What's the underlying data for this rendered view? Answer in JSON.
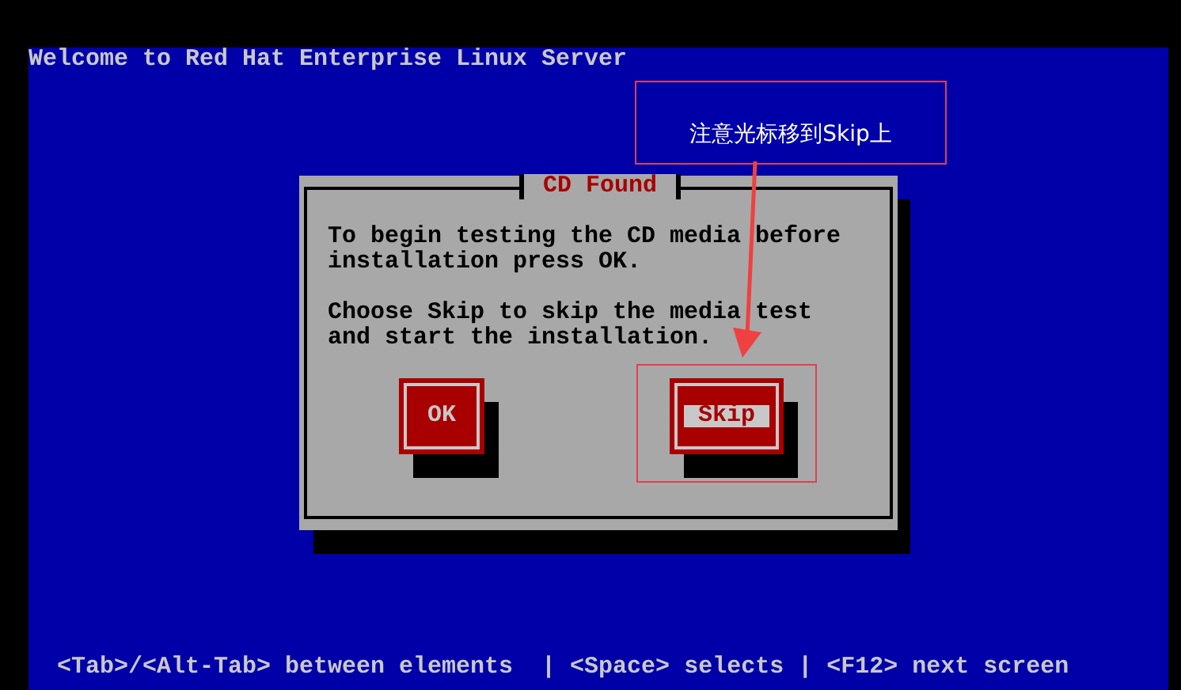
{
  "screen": {
    "title": "Welcome to Red Hat Enterprise Linux Server"
  },
  "dialog": {
    "title": "CD Found",
    "paragraphs": [
      "To begin testing the CD media before installation press OK.",
      "Choose Skip to skip the media test and start the installation."
    ],
    "buttons": [
      {
        "label": "OK",
        "selected": false
      },
      {
        "label": "Skip",
        "selected": true
      }
    ]
  },
  "help_line": "<Tab>/<Alt-Tab> between elements  | <Space> selects | <F12> next screen",
  "annotation": {
    "text": "注意光标移到Skip上"
  }
}
